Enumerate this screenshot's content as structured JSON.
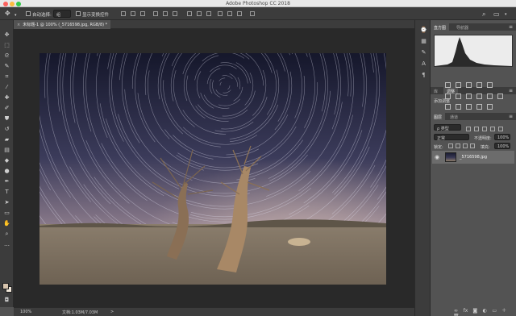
{
  "window": {
    "title": "Adobe Photoshop CC 2018"
  },
  "options_bar": {
    "auto_select_label": "自动选择:",
    "auto_select_value": "组",
    "show_transform_label": "显示变换控件"
  },
  "document": {
    "tab_title": "未标题-1 @ 100% (_5716598.jpg, RGB/8) *"
  },
  "status": {
    "zoom": "100%",
    "doc_info": "文档:1.03M/7.03M",
    "arrow": ">"
  },
  "panels": {
    "histogram_tabs": [
      "直方图",
      "导航器"
    ],
    "adjust_tabs": [
      "库",
      "调整"
    ],
    "adjust_title": "添加调整",
    "layers_tabs": [
      "图层",
      "通道"
    ],
    "layers_filter": "ρ 类型",
    "blend_mode": "正常",
    "opacity_label": "不透明度:",
    "opacity_value": "100%",
    "lock_label": "锁定:",
    "fill_label": "填充:",
    "fill_value": "100%",
    "layer_name": "_5716598.jpg"
  },
  "colors": {
    "foreground": "#d7c4ad",
    "background": "#f0e6d8",
    "workspace": "#292929",
    "panel": "#535353"
  }
}
